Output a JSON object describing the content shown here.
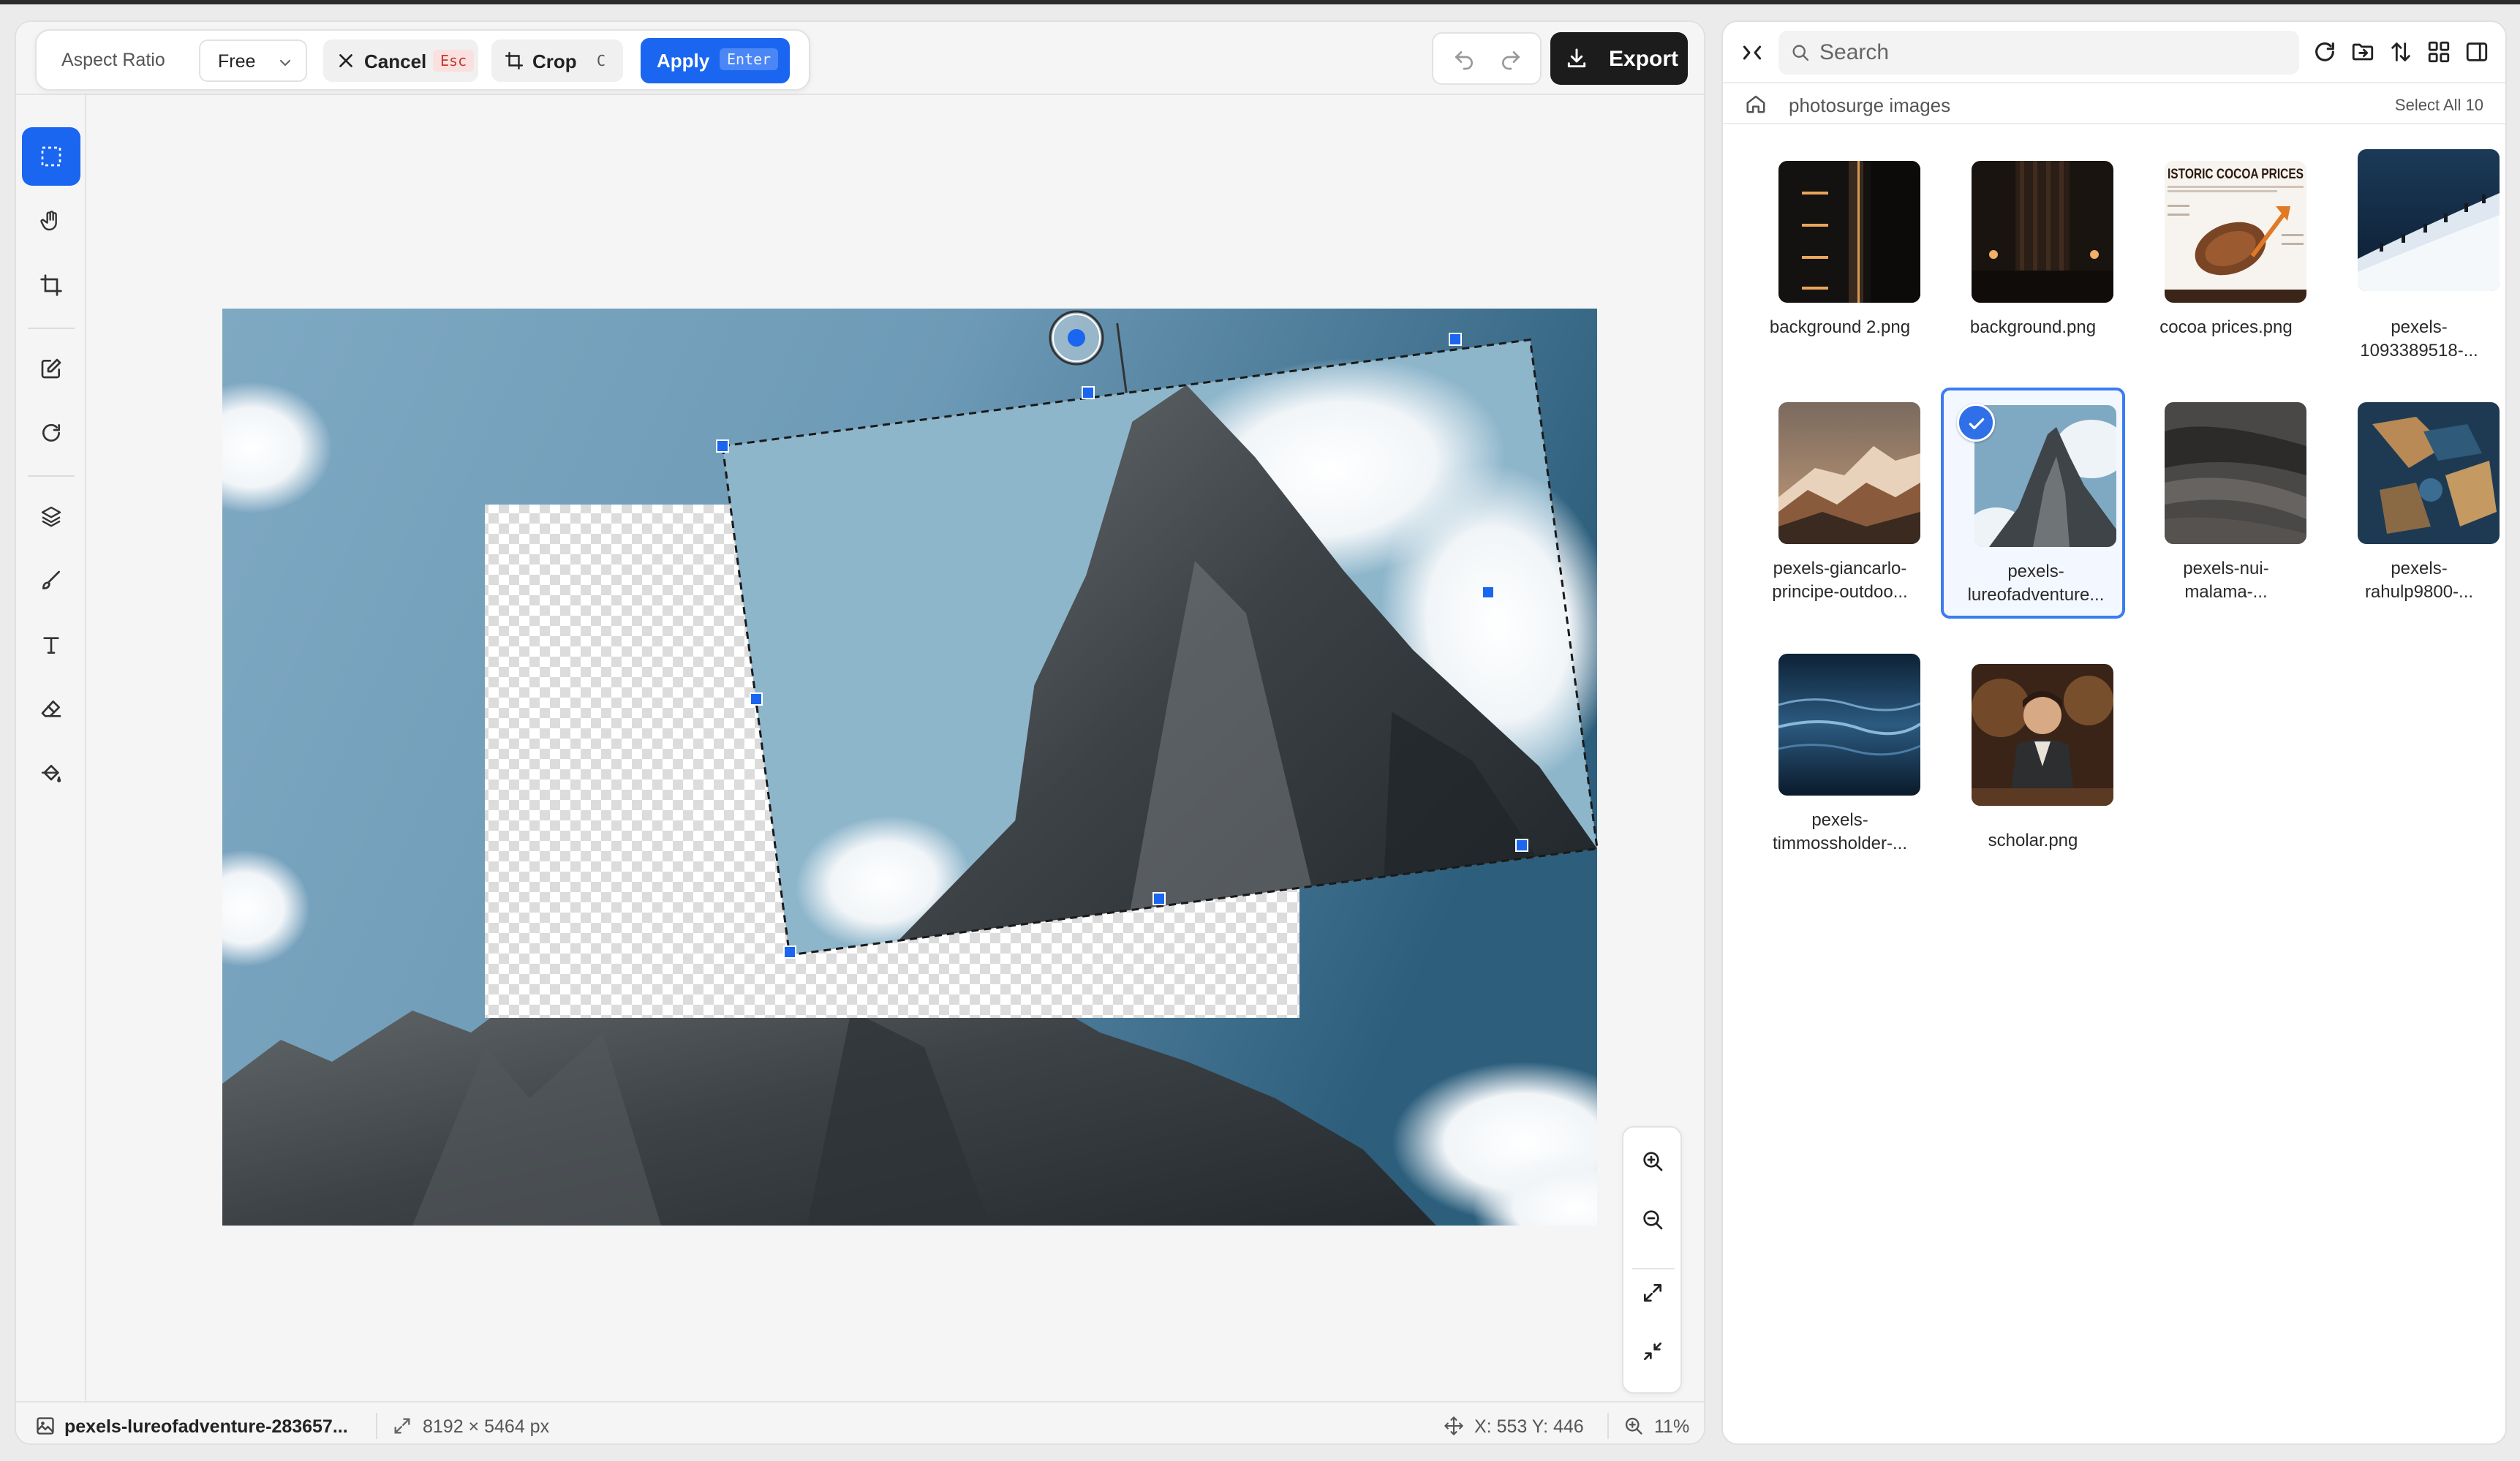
{
  "toolbar_top": {
    "aspect_ratio_label": "Aspect Ratio",
    "aspect_ratio_value": "Free",
    "cancel_label": "Cancel",
    "cancel_key": "Esc",
    "crop_label": "Crop",
    "crop_key": "C",
    "apply_label": "Apply",
    "apply_key": "Enter",
    "export_label": "Export"
  },
  "tools": [
    "select-tool",
    "hand-tool",
    "crop-tool",
    "edit-tool",
    "rotate-tool",
    "layers-tool",
    "brush-tool",
    "text-tool",
    "eraser-tool",
    "fill-tool"
  ],
  "active_tool": "select-tool",
  "status": {
    "file_name": "pexels-lureofadventure-283657...",
    "dimensions": "8192 × 5464 px",
    "cursor": "X: 553 Y: 446",
    "zoom": "11%"
  },
  "files_panel": {
    "search_placeholder": "Search",
    "folder": "photosurge images",
    "select_all": "Select All 10",
    "items": [
      {
        "line1": "background 2.png",
        "line2": "",
        "thumb": "dark-interior"
      },
      {
        "line1": "background.png",
        "line2": "",
        "thumb": "dark-room"
      },
      {
        "line1": "cocoa prices.png",
        "line2": "",
        "thumb": "cocoa-infographic",
        "thumb_text": "ISTORIC COCOA PRICES"
      },
      {
        "line1": "pexels-",
        "line2": "1093389518-...",
        "thumb": "snowy-climbers"
      },
      {
        "line1": "pexels-giancarlo-",
        "line2": "principe-outdoo...",
        "thumb": "mountain-sunset"
      },
      {
        "line1": "pexels-",
        "line2": "lureofadventure...",
        "thumb": "mountain-peak",
        "selected": true
      },
      {
        "line1": "pexels-nui-",
        "line2": "malama-...",
        "thumb": "dark-texture"
      },
      {
        "line1": "pexels-",
        "line2": "rahulp9800-...",
        "thumb": "blue-stone"
      },
      {
        "line1": "pexels-",
        "line2": "timmossholder-...",
        "thumb": "water"
      },
      {
        "line1": "scholar.png",
        "line2": "",
        "thumb": "scholar-portrait"
      }
    ]
  },
  "colors": {
    "accent": "#1a66f0",
    "export_bg": "#1c1c1c",
    "cancel_key_bg": "#fbe0e0"
  }
}
